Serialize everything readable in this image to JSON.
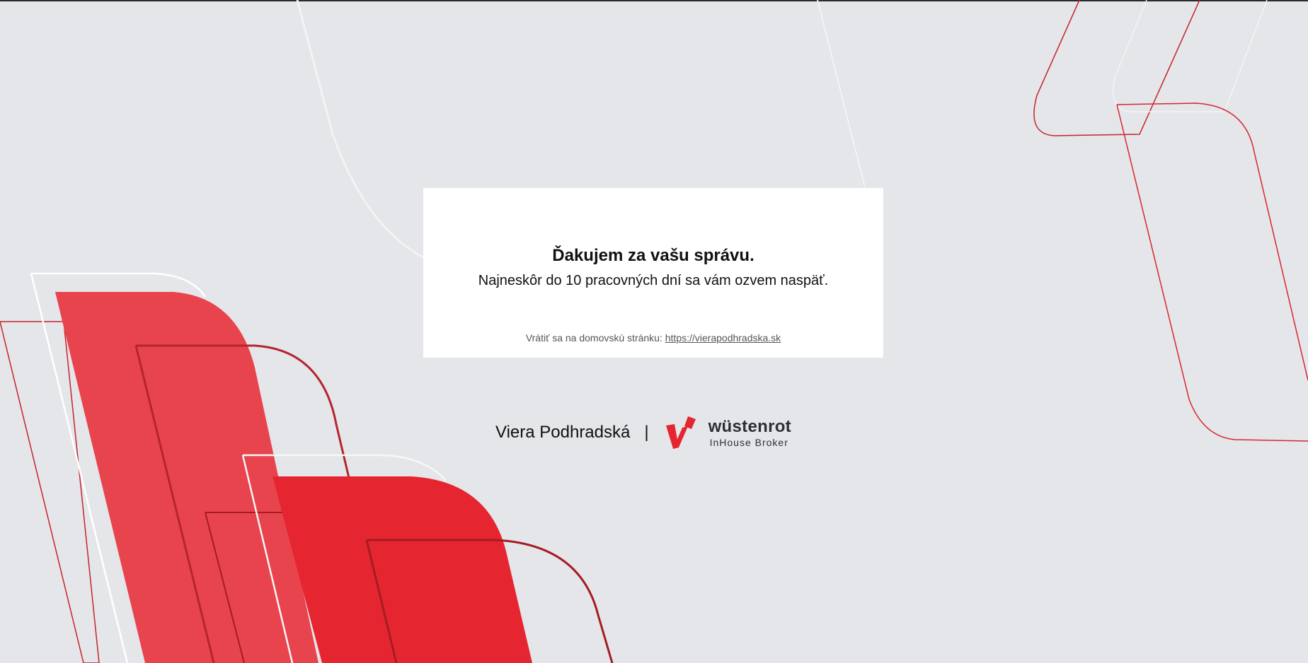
{
  "message": {
    "title": "Ďakujem za vašu správu.",
    "subtitle": "Najneskôr do 10 pracovných dní sa vám ozvem naspäť.",
    "return_text": "Vrátiť sa na domovskú stránku:",
    "return_link": "https://vierapodhradska.sk"
  },
  "footer": {
    "name": "Viera Podhradská",
    "separator": "|",
    "logo": {
      "icon": "wustenrot-logo-icon",
      "word": "wüstenrot",
      "tagline": "InHouse Broker"
    }
  },
  "colors": {
    "background": "#e5e6e9",
    "card": "#ffffff",
    "brand_red": "#e52630",
    "light_red": "#e8444d",
    "dark_red": "#a51c24"
  }
}
